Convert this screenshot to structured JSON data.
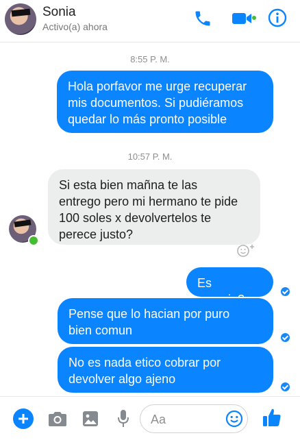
{
  "header": {
    "contact_name": "Sonia",
    "status": "Activo(a) ahora",
    "icons": [
      "avatar",
      "phone-icon",
      "video-camera-icon",
      "info-icon"
    ],
    "accent_color": "#0a84ff",
    "online_color": "#45bd33"
  },
  "messages": [
    {
      "type": "timestamp",
      "text": "8:55 P. M."
    },
    {
      "type": "outgoing",
      "text": "Hola porfavor me urge recuperar\nmis documentos. Si pudiéramos\nquedar lo más pronto posible"
    },
    {
      "type": "timestamp",
      "text": "10:57 P. M."
    },
    {
      "type": "incoming",
      "text": "Si esta bien mañna te las\nentrego pero mi hermano te pide\n100 soles x devolvertelos te\nperece justo?"
    },
    {
      "type": "outgoing",
      "text": "Es enserio?"
    },
    {
      "type": "outgoing",
      "text": "Pense que lo hacian por puro\nbien comun"
    },
    {
      "type": "outgoing",
      "text": "No es nada etico cobrar por\ndevolver algo ajeno"
    }
  ],
  "composer": {
    "placeholder": "Aa",
    "icons": [
      "plus-icon",
      "camera-icon",
      "gallery-icon",
      "microphone-icon",
      "emoji-icon",
      "thumbs-up-icon"
    ]
  }
}
